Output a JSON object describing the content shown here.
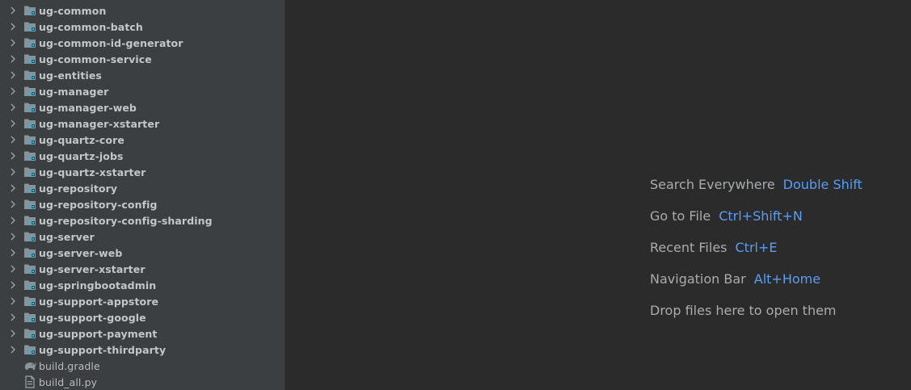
{
  "project_tree": {
    "items": [
      {
        "label": "ug-common",
        "type": "module"
      },
      {
        "label": "ug-common-batch",
        "type": "module"
      },
      {
        "label": "ug-common-id-generator",
        "type": "module"
      },
      {
        "label": "ug-common-service",
        "type": "module"
      },
      {
        "label": "ug-entities",
        "type": "module"
      },
      {
        "label": "ug-manager",
        "type": "module"
      },
      {
        "label": "ug-manager-web",
        "type": "module"
      },
      {
        "label": "ug-manager-xstarter",
        "type": "module"
      },
      {
        "label": "ug-quartz-core",
        "type": "module"
      },
      {
        "label": "ug-quartz-jobs",
        "type": "module"
      },
      {
        "label": "ug-quartz-xstarter",
        "type": "module"
      },
      {
        "label": "ug-repository",
        "type": "module"
      },
      {
        "label": "ug-repository-config",
        "type": "module"
      },
      {
        "label": "ug-repository-config-sharding",
        "type": "module"
      },
      {
        "label": "ug-server",
        "type": "module"
      },
      {
        "label": "ug-server-web",
        "type": "module"
      },
      {
        "label": "ug-server-xstarter",
        "type": "module"
      },
      {
        "label": "ug-springbootadmin",
        "type": "module"
      },
      {
        "label": "ug-support-appstore",
        "type": "module"
      },
      {
        "label": "ug-support-google",
        "type": "module"
      },
      {
        "label": "ug-support-payment",
        "type": "module"
      },
      {
        "label": "ug-support-thirdparty",
        "type": "module"
      },
      {
        "label": "build.gradle",
        "type": "gradle-file"
      },
      {
        "label": "build_all.py",
        "type": "python-file"
      }
    ]
  },
  "editor_hints": [
    {
      "text": "Search Everywhere",
      "shortcut": "Double Shift"
    },
    {
      "text": "Go to File",
      "shortcut": "Ctrl+Shift+N"
    },
    {
      "text": "Recent Files",
      "shortcut": "Ctrl+E"
    },
    {
      "text": "Navigation Bar",
      "shortcut": "Alt+Home"
    },
    {
      "text": "Drop files here to open them",
      "shortcut": ""
    }
  ],
  "icons": {
    "chevron": "chevron-right-icon",
    "module": "module-folder-icon",
    "gradle": "gradle-elephant-icon",
    "python": "python-file-icon"
  },
  "colors": {
    "sidebar_bg": "#3c3f41",
    "editor_bg": "#2b2b2b",
    "label": "#c3c6c9",
    "hint_text": "#a9abad",
    "shortcut": "#589df6"
  }
}
